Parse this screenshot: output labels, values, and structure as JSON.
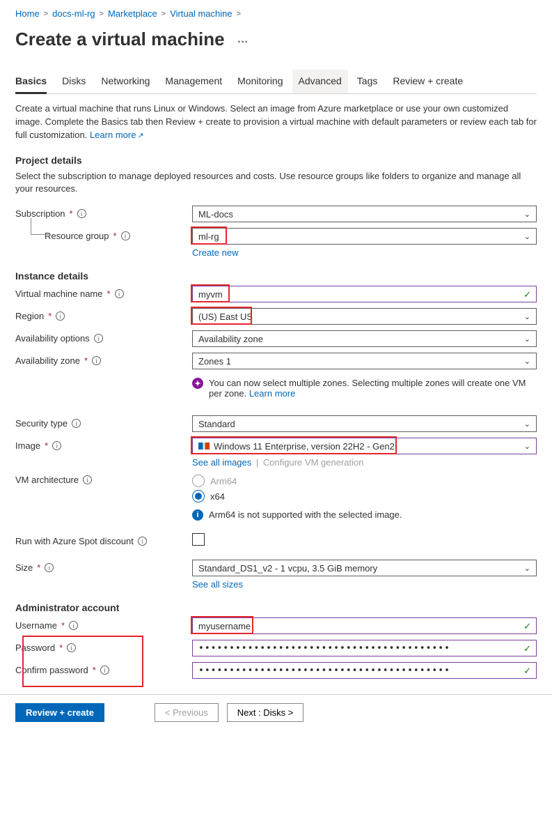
{
  "breadcrumb": [
    "Home",
    "docs-ml-rg",
    "Marketplace",
    "Virtual machine"
  ],
  "title": "Create a virtual machine",
  "tabs": [
    "Basics",
    "Disks",
    "Networking",
    "Management",
    "Monitoring",
    "Advanced",
    "Tags",
    "Review + create"
  ],
  "intro": "Create a virtual machine that runs Linux or Windows. Select an image from Azure marketplace or use your own customized image. Complete the Basics tab then Review + create to provision a virtual machine with default parameters or review each tab for full customization.",
  "learn_more": "Learn more",
  "project": {
    "heading": "Project details",
    "desc": "Select the subscription to manage deployed resources and costs. Use resource groups like folders to organize and manage all your resources.",
    "subscription_label": "Subscription",
    "subscription_value": "ML-docs",
    "rg_label": "Resource group",
    "rg_value": "ml-rg",
    "create_new": "Create new"
  },
  "instance": {
    "heading": "Instance details",
    "vm_name_label": "Virtual machine name",
    "vm_name_value": "myvm",
    "region_label": "Region",
    "region_value": "(US) East US",
    "avail_opt_label": "Availability options",
    "avail_opt_value": "Availability zone",
    "avail_zone_label": "Availability zone",
    "avail_zone_value": "Zones 1",
    "zone_info": "You can now select multiple zones. Selecting multiple zones will create one VM per zone.",
    "sec_type_label": "Security type",
    "sec_type_value": "Standard",
    "image_label": "Image",
    "image_value": "Windows 11 Enterprise, version 22H2 - Gen2",
    "see_all_images": "See all images",
    "config_gen": "Configure VM generation",
    "arch_label": "VM architecture",
    "arch_arm": "Arm64",
    "arch_x64": "x64",
    "arm_info": "Arm64 is not supported with the selected image.",
    "spot_label": "Run with Azure Spot discount",
    "size_label": "Size",
    "size_value": "Standard_DS1_v2 - 1 vcpu, 3.5 GiB memory",
    "see_all_sizes": "See all sizes"
  },
  "admin": {
    "heading": "Administrator account",
    "user_label": "Username",
    "user_value": "myusername",
    "pw_label": "Password",
    "pw_value": "•••••••••••••••••••••••••••••••••••••••••",
    "cpw_label": "Confirm password",
    "cpw_value": "•••••••••••••••••••••••••••••••••••••••••"
  },
  "footer": {
    "review": "Review + create",
    "prev": "< Previous",
    "next": "Next : Disks >"
  }
}
